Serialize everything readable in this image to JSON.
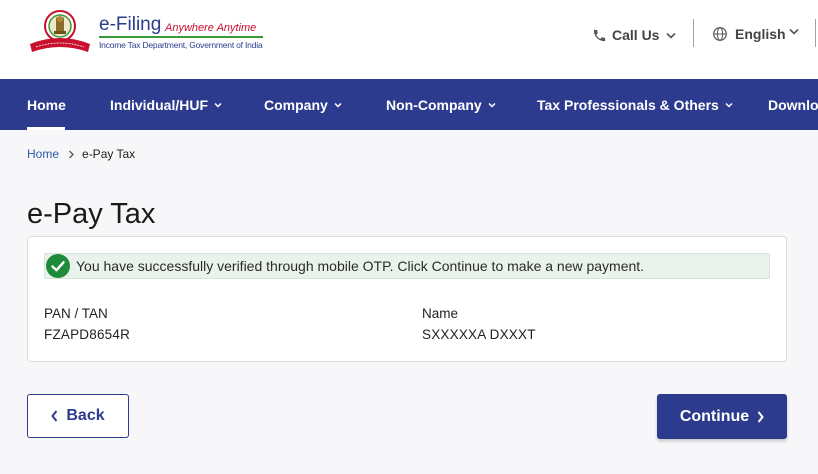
{
  "header": {
    "brand_title": "e-Filing",
    "brand_tagline": "Anywhere Anytime",
    "brand_subtitle": "Income Tax Department, Government of India",
    "call_us": "Call Us",
    "language": "English"
  },
  "nav": {
    "items": [
      {
        "label": "Home",
        "active": true
      },
      {
        "label": "Individual/HUF"
      },
      {
        "label": "Company"
      },
      {
        "label": "Non-Company"
      },
      {
        "label": "Tax Professionals & Others"
      },
      {
        "label": "Downloads"
      }
    ]
  },
  "breadcrumb": {
    "home": "Home",
    "current": "e-Pay Tax"
  },
  "page": {
    "title": "e-Pay Tax"
  },
  "card": {
    "alert": "You have successfully verified through mobile OTP. Click Continue to make a new payment.",
    "pan_label": "PAN / TAN",
    "pan_value": "FZAPD8654R",
    "name_label": "Name",
    "name_value": "SXXXXXA DXXXT"
  },
  "actions": {
    "back": "Back",
    "continue": "Continue"
  },
  "colors": {
    "primary": "#2d3b8e",
    "success": "#1e8a3c",
    "alert_bg": "#e9f3eb",
    "link": "#2d5ba8"
  }
}
